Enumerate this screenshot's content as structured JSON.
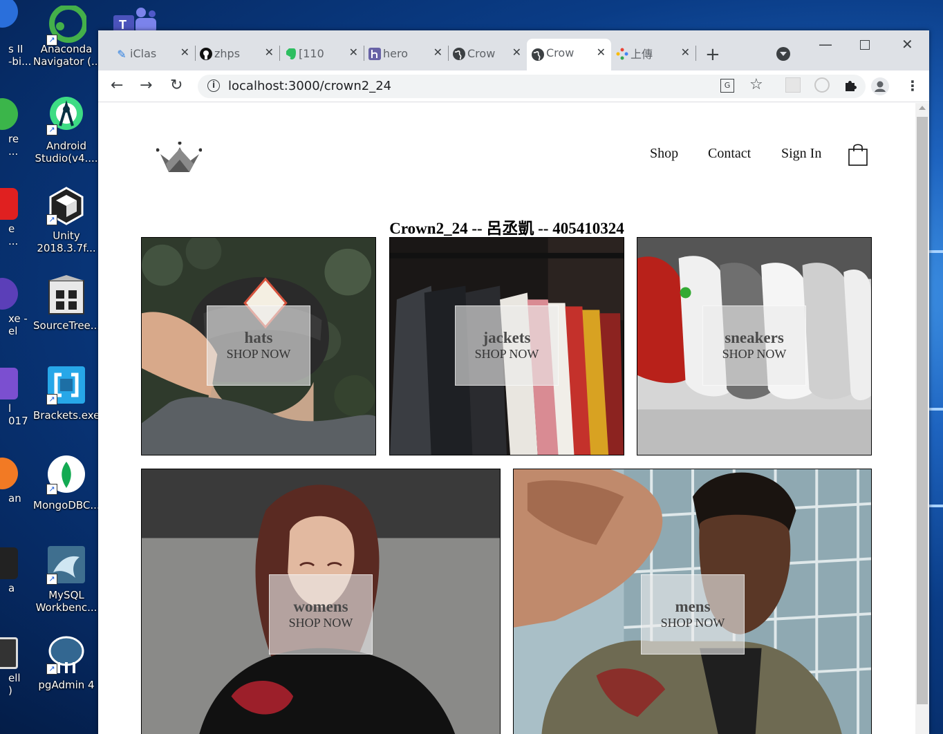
{
  "desktop": {
    "icons": [
      {
        "label": "Anaconda\nNavigator (...",
        "icon": "anaconda-icon"
      },
      {
        "label": "Android\nStudio(v4....",
        "icon": "android-studio-icon"
      },
      {
        "label": "Unity\n2018.3.7f...",
        "icon": "unity-icon"
      },
      {
        "label": "SourceTree...",
        "icon": "sourcetree-icon"
      },
      {
        "label": "Brackets.exe",
        "icon": "brackets-icon"
      },
      {
        "label": "MongoDBC...",
        "icon": "mongodb-icon"
      },
      {
        "label": "MySQL\nWorkbenc...",
        "icon": "mysql-icon"
      },
      {
        "label": "pgAdmin 4",
        "icon": "pgadmin-icon"
      }
    ],
    "cut_labels": [
      "s II\n-bi...",
      "re\n...",
      "e\n...",
      "xe -\nel",
      "l\n017",
      "an",
      "a",
      "ell\n)"
    ]
  },
  "browser": {
    "tabs": [
      {
        "title": "iClas",
        "icon": "iclass-icon"
      },
      {
        "title": "zhps",
        "icon": "github-icon"
      },
      {
        "title": "[110",
        "icon": "evernote-icon"
      },
      {
        "title": "hero",
        "icon": "heroku-icon"
      },
      {
        "title": "Crow",
        "icon": "globe-icon"
      },
      {
        "title": "Crow",
        "icon": "globe-icon"
      },
      {
        "title": "上傳",
        "icon": "google-photos-icon"
      }
    ],
    "url": "localhost:3000/crown2_24"
  },
  "page": {
    "nav": {
      "shop": "Shop",
      "contact": "Contact",
      "sign_in": "Sign In"
    },
    "title": "Crown2_24 -- 呂丞凱 -- 405410324",
    "sections": [
      {
        "title": "hats",
        "subtitle": "SHOP NOW"
      },
      {
        "title": "jackets",
        "subtitle": "SHOP NOW"
      },
      {
        "title": "sneakers",
        "subtitle": "SHOP NOW"
      },
      {
        "title": "womens",
        "subtitle": "SHOP NOW"
      },
      {
        "title": "mens",
        "subtitle": "SHOP NOW"
      }
    ]
  }
}
